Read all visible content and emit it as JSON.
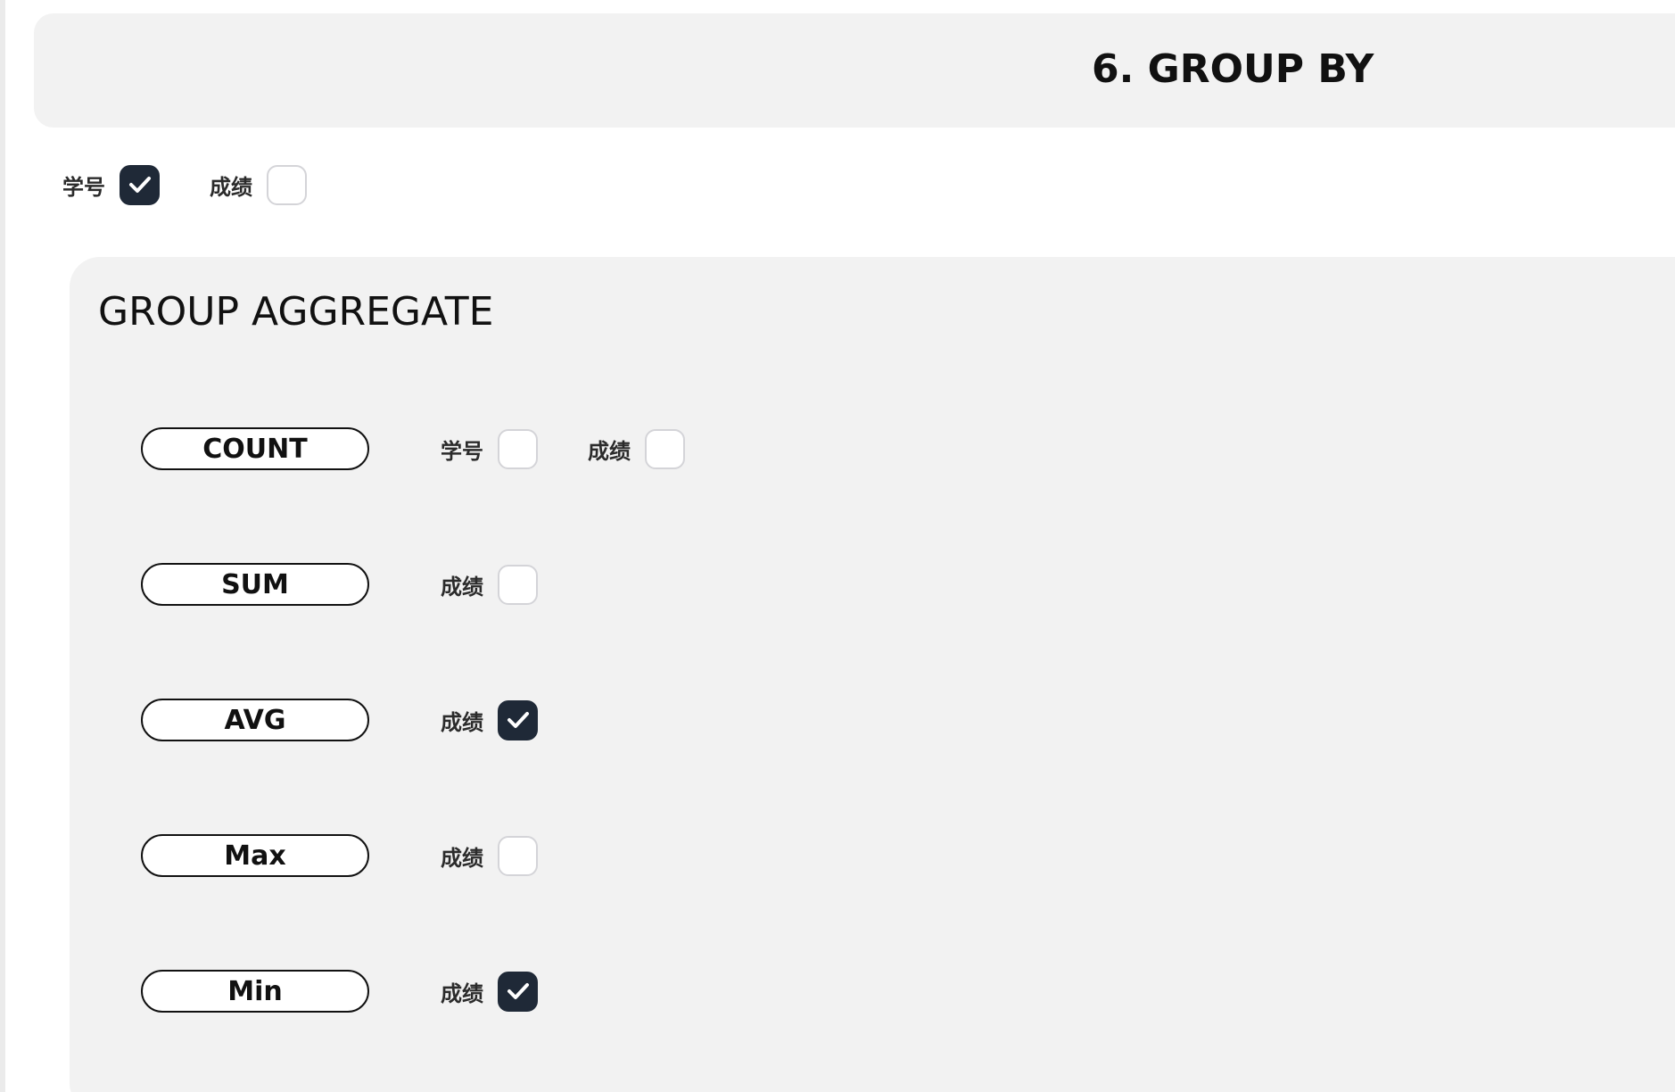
{
  "section": {
    "title": "6. GROUP BY"
  },
  "group_by": {
    "options": [
      {
        "label": "学号",
        "checked": true
      },
      {
        "label": "成绩",
        "checked": false
      }
    ]
  },
  "aggregate": {
    "title": "GROUP AGGREGATE",
    "rows": [
      {
        "function": "COUNT",
        "columns": [
          {
            "label": "学号",
            "checked": false
          },
          {
            "label": "成绩",
            "checked": false
          }
        ]
      },
      {
        "function": "SUM",
        "columns": [
          {
            "label": "成绩",
            "checked": false
          }
        ]
      },
      {
        "function": "AVG",
        "columns": [
          {
            "label": "成绩",
            "checked": true
          }
        ]
      },
      {
        "function": "Max",
        "columns": [
          {
            "label": "成绩",
            "checked": false
          }
        ]
      },
      {
        "function": "Min",
        "columns": [
          {
            "label": "成绩",
            "checked": true
          }
        ]
      }
    ]
  },
  "icons": {
    "checked_mark": "check-icon"
  },
  "colors": {
    "checked_fill": "#1f2937",
    "panel_bg": "#f2f2f2"
  }
}
